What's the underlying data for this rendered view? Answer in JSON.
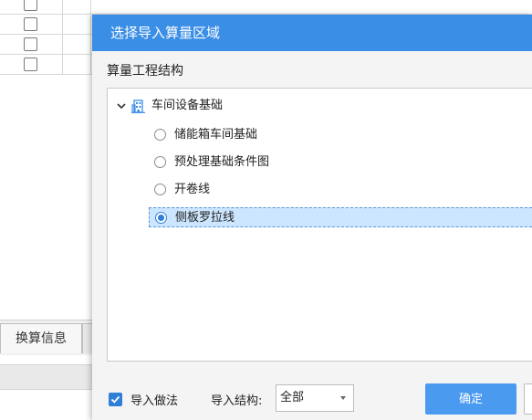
{
  "background": {
    "tab_label": "换算信息"
  },
  "dialog": {
    "title": "选择导入算量区域",
    "section_label": "算量工程结构",
    "tree": {
      "root_label": "车间设备基础",
      "items": [
        {
          "label": "储能箱车间基础",
          "selected": false
        },
        {
          "label": "预处理基础条件图",
          "selected": false
        },
        {
          "label": "开卷线",
          "selected": false
        },
        {
          "label": "侧板罗拉线",
          "selected": true
        }
      ]
    },
    "footer": {
      "import_method_label": "导入做法",
      "import_method_checked": true,
      "import_structure_label": "导入结构:",
      "import_structure_value": "全部",
      "ok_label": "确定"
    }
  },
  "colors": {
    "titlebar": "#3a8ee6",
    "accent": "#2f7fd9",
    "selection": "#cde6ff"
  }
}
